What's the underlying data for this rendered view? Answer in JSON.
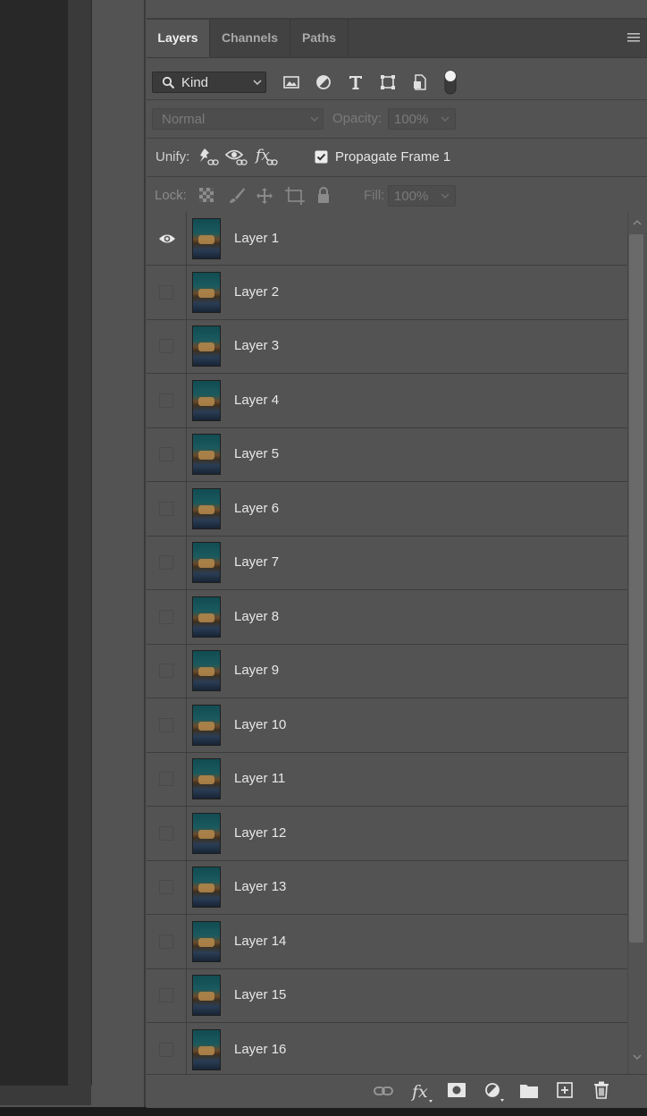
{
  "panel": {
    "tabs": [
      {
        "label": "Layers",
        "active": true
      },
      {
        "label": "Channels",
        "active": false
      },
      {
        "label": "Paths",
        "active": false
      }
    ],
    "filter": {
      "kind_label": "Kind"
    },
    "blend": {
      "mode": "Normal",
      "opacity_label": "Opacity:",
      "opacity_value": "100%"
    },
    "unify": {
      "label": "Unify:",
      "propagate_label": "Propagate Frame 1",
      "propagate_checked": true
    },
    "lock": {
      "label": "Lock:",
      "fill_label": "Fill:",
      "fill_value": "100%"
    },
    "layers": [
      {
        "name": "Layer 1",
        "visible": true
      },
      {
        "name": "Layer 2",
        "visible": false
      },
      {
        "name": "Layer 3",
        "visible": false
      },
      {
        "name": "Layer 4",
        "visible": false
      },
      {
        "name": "Layer 5",
        "visible": false
      },
      {
        "name": "Layer 6",
        "visible": false
      },
      {
        "name": "Layer 7",
        "visible": false
      },
      {
        "name": "Layer 8",
        "visible": false
      },
      {
        "name": "Layer 9",
        "visible": false
      },
      {
        "name": "Layer 10",
        "visible": false
      },
      {
        "name": "Layer 11",
        "visible": false
      },
      {
        "name": "Layer 12",
        "visible": false
      },
      {
        "name": "Layer 13",
        "visible": false
      },
      {
        "name": "Layer 14",
        "visible": false
      },
      {
        "name": "Layer 15",
        "visible": false
      },
      {
        "name": "Layer 16",
        "visible": false
      }
    ],
    "icons": {
      "filter": [
        "image-filter-icon",
        "adjustment-filter-icon",
        "type-filter-icon",
        "shape-filter-icon",
        "smart-object-filter-icon",
        "filter-toggle-icon"
      ],
      "lock": [
        "lock-transparent-pixels-icon",
        "lock-image-pixels-icon",
        "lock-position-icon",
        "lock-artboard-icon",
        "lock-all-icon"
      ],
      "footer": [
        "link-layers-icon",
        "fx-icon",
        "add-mask-icon",
        "new-adjustment-layer-icon",
        "new-group-icon",
        "new-layer-icon",
        "delete-layer-icon"
      ]
    }
  }
}
